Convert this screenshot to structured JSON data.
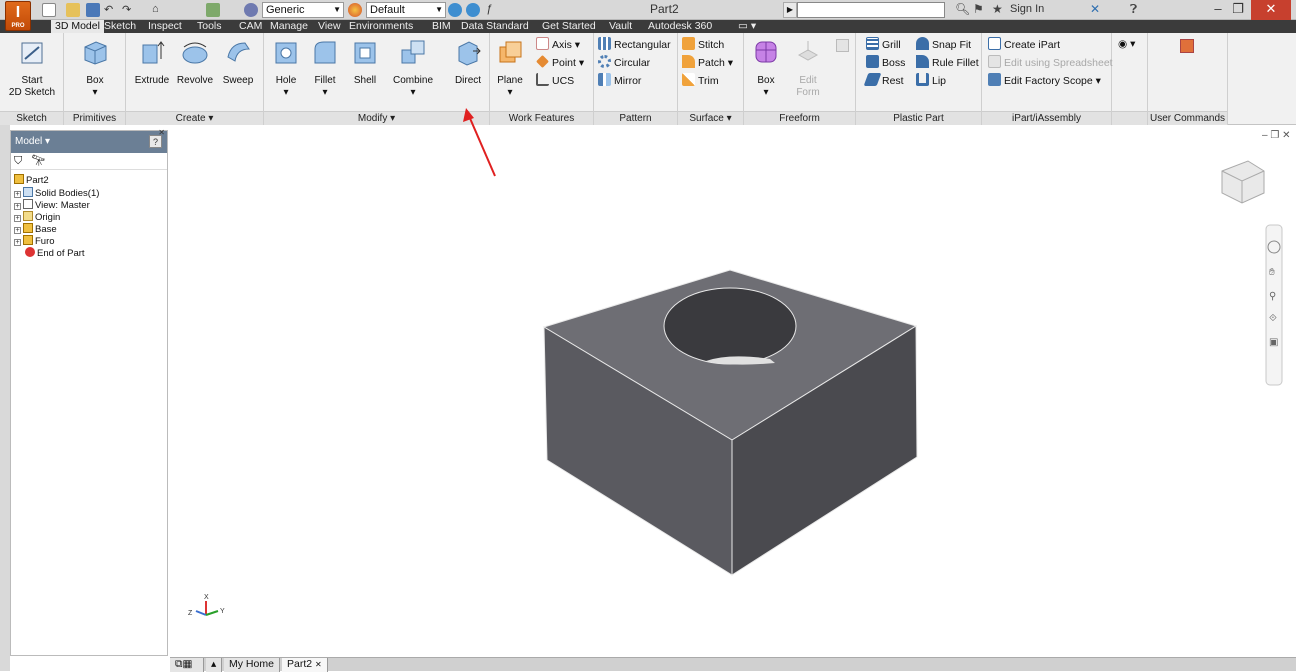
{
  "app": {
    "logo_text": "I",
    "logo_sub": "PRO",
    "document_title": "Part2",
    "signin": "Sign In"
  },
  "quick_access": {
    "material": "Generic",
    "appearance": "Default"
  },
  "tabs": [
    "3D Model",
    "Sketch",
    "Inspect",
    "Tools",
    "CAM",
    "Manage",
    "View",
    "Environments",
    "BIM",
    "Data Standard",
    "Get Started",
    "Vault",
    "Autodesk 360"
  ],
  "active_tab": "3D Model",
  "ribbon": {
    "sketch": {
      "title": "Sketch",
      "start": "Start",
      "start2": "2D Sketch"
    },
    "primitives": {
      "title": "Primitives",
      "box": "Box"
    },
    "create": {
      "title": "Create ▾",
      "extrude": "Extrude",
      "revolve": "Revolve",
      "sweep": "Sweep"
    },
    "modify": {
      "title": "Modify ▾",
      "hole": "Hole",
      "fillet": "Fillet",
      "shell": "Shell",
      "combine": "Combine",
      "direct": "Direct"
    },
    "work_features": {
      "title": "Work Features",
      "plane": "Plane",
      "axis": "Axis ▾",
      "point": "Point ▾",
      "ucs": "UCS"
    },
    "pattern": {
      "title": "Pattern",
      "rectangular": "Rectangular",
      "circular": "Circular",
      "mirror": "Mirror"
    },
    "surface": {
      "title": "Surface ▾",
      "stitch": "Stitch",
      "patch": "Patch ▾",
      "trim": "Trim"
    },
    "freeform": {
      "title": "Freeform",
      "box": "Box",
      "edit": "Edit",
      "edit2": "Form"
    },
    "plastic": {
      "title": "Plastic Part",
      "grill": "Grill",
      "snap": "Snap Fit",
      "boss": "Boss",
      "rule": "Rule Fillet",
      "rest": "Rest",
      "lip": "Lip"
    },
    "ipart": {
      "title": "iPart/iAssembly",
      "create": "Create iPart",
      "spreadsheet": "Edit using Spreadsheet",
      "factory": "Edit Factory Scope ▾"
    },
    "user": {
      "title": "User Commands"
    }
  },
  "browser": {
    "title": "Model ▾",
    "items": [
      "Part2",
      "Solid Bodies(1)",
      "View: Master",
      "Origin",
      "Base",
      "Furo",
      "End of Part"
    ]
  },
  "doc_tabs": {
    "home": "My Home",
    "part": "Part2"
  },
  "colors": {
    "accent": "#c24a07",
    "tabbar": "#3b3b3b",
    "browser_head": "#6b7f95",
    "arrow": "#e02020"
  }
}
